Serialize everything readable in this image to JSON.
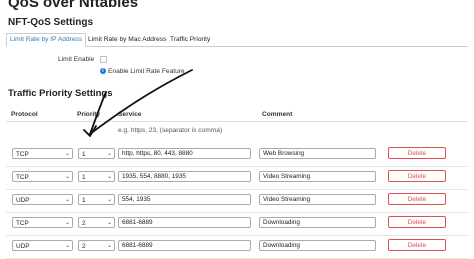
{
  "page": {
    "title": "QoS over Nftables",
    "subtitle": "NFT-QoS Settings"
  },
  "tabs": [
    {
      "label": "Limit Rate by IP Address",
      "active": true
    },
    {
      "label": "Limit Rate by Mac Address",
      "active": false
    },
    {
      "label": "Traffic Priority",
      "active": false
    }
  ],
  "limit": {
    "label": "Limit Enable",
    "checked": false,
    "hint": "Enable Limit Rate Feature"
  },
  "priority_section": {
    "title": "Traffic Priority Settings",
    "columns": {
      "protocol": "Protocol",
      "priority": "Priority",
      "service": "Service",
      "comment": "Comment"
    },
    "service_hint": "e.g. https, 23, (separator is comma)",
    "rows": [
      {
        "protocol": "TCP",
        "priority": "1",
        "service": "http, https, 80, 443, 8880",
        "comment": "Web Browsing",
        "delete": "Delete"
      },
      {
        "protocol": "TCP",
        "priority": "1",
        "service": "1935, 554, 8880, 1935",
        "comment": "Video Streaming",
        "delete": "Delete"
      },
      {
        "protocol": "UDP",
        "priority": "1",
        "service": "554, 1935",
        "comment": "Video Streaming",
        "delete": "Delete"
      },
      {
        "protocol": "TCP",
        "priority": "2",
        "service": "6881-6889",
        "comment": "Downloading",
        "delete": "Delete"
      },
      {
        "protocol": "UDP",
        "priority": "2",
        "service": "6881-6889",
        "comment": "Downloading",
        "delete": "Delete"
      }
    ]
  },
  "icons": {
    "select_arrow": "chevron-down-icon",
    "info": "info-icon"
  },
  "colors": {
    "active_tab": "#337ab7",
    "delete": "#d9534f",
    "info": "#1e73d8"
  }
}
